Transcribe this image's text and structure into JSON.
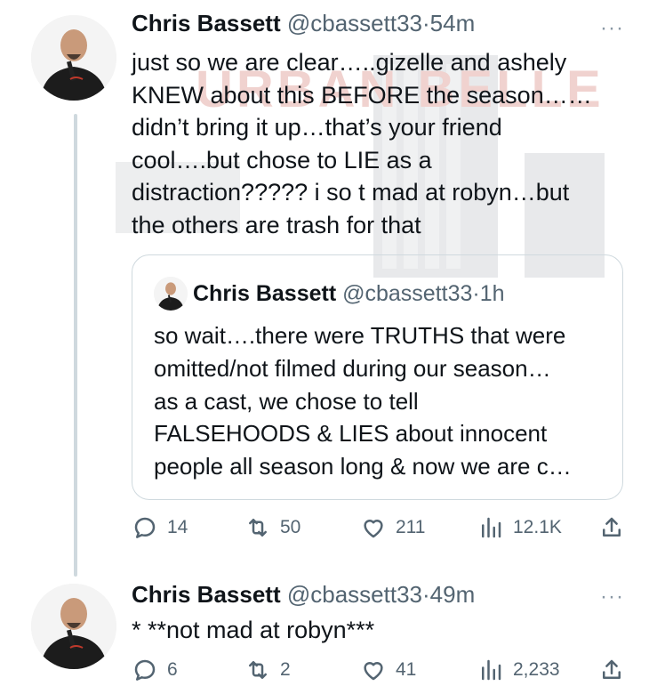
{
  "tweets": [
    {
      "author_name": "Chris Bassett",
      "handle": "@cbassett33",
      "separator": "·",
      "time": "54m",
      "more_label": "···",
      "text": "just so we are clear…..gizelle and ashely\nKNEW about this BEFORE the season……\ndidn’t bring it up…that’s your friend\ncool….but chose to LIE as a\ndistraction????? i so t mad at robyn…but\nthe others are trash for that",
      "quoted": {
        "author_name": "Chris Bassett",
        "handle": "@cbassett33",
        "separator": "·",
        "time": "1h",
        "text": "so wait….there were TRUTHS that were\nomitted/not filmed during our season…\nas a cast, we chose to tell\nFALSEHOODS & LIES about innocent\npeople all season long & now we are c…"
      },
      "actions": {
        "replies": "14",
        "retweets": "50",
        "likes": "211",
        "views": "12.1K"
      }
    },
    {
      "author_name": "Chris Bassett",
      "handle": "@cbassett33",
      "separator": "·",
      "time": "49m",
      "more_label": "···",
      "text": "* **not mad at robyn***",
      "actions": {
        "replies": "6",
        "retweets": "2",
        "likes": "41",
        "views": "2,233"
      }
    }
  ],
  "background_watermark": "URBAN BELLE",
  "colors": {
    "text": "#0f1419",
    "secondary": "#536471",
    "border": "#cfd9de",
    "watermark": "#c0392b"
  },
  "icons": [
    "reply-icon",
    "retweet-icon",
    "like-icon",
    "views-icon",
    "share-icon",
    "more-icon"
  ]
}
